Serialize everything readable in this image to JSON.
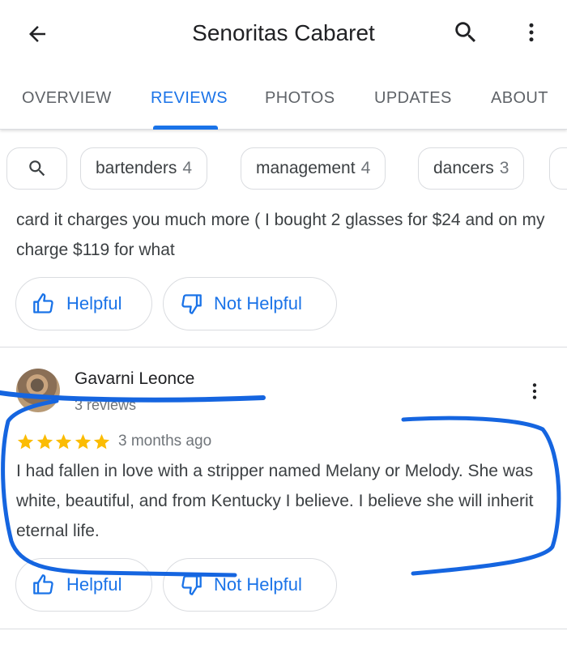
{
  "appbar": {
    "title": "Senoritas Cabaret",
    "back_icon": "arrow-back-icon",
    "search_icon": "search-icon",
    "more_icon": "more-vert-icon"
  },
  "tabs": [
    {
      "label": "OVERVIEW",
      "active": false
    },
    {
      "label": "REVIEWS",
      "active": true
    },
    {
      "label": "PHOTOS",
      "active": false
    },
    {
      "label": "UPDATES",
      "active": false
    },
    {
      "label": "ABOUT",
      "active": false
    }
  ],
  "chips": [
    {
      "label": "bartenders",
      "count": "4"
    },
    {
      "label": "management",
      "count": "4"
    },
    {
      "label": "dancers",
      "count": "3"
    }
  ],
  "reviews": [
    {
      "text": "card it charges you much more ( I bought 2 glasses for $24 and on my charge $119 for what",
      "helpful_label": "Helpful",
      "not_helpful_label": "Not Helpful"
    },
    {
      "author": "Gavarni Leonce",
      "author_sub": "3 reviews",
      "rating": 5,
      "date": "3 months ago",
      "text": "I had fallen in love with a stripper named Melany or Melody. She was white, beautiful, and from Kentucky I believe. I believe she will inherit eternal life.",
      "helpful_label": "Helpful",
      "not_helpful_label": "Not Helpful"
    }
  ],
  "colors": {
    "accent": "#1a73e8",
    "star": "#fbbc04",
    "annotation_ink": "#1565e0"
  }
}
